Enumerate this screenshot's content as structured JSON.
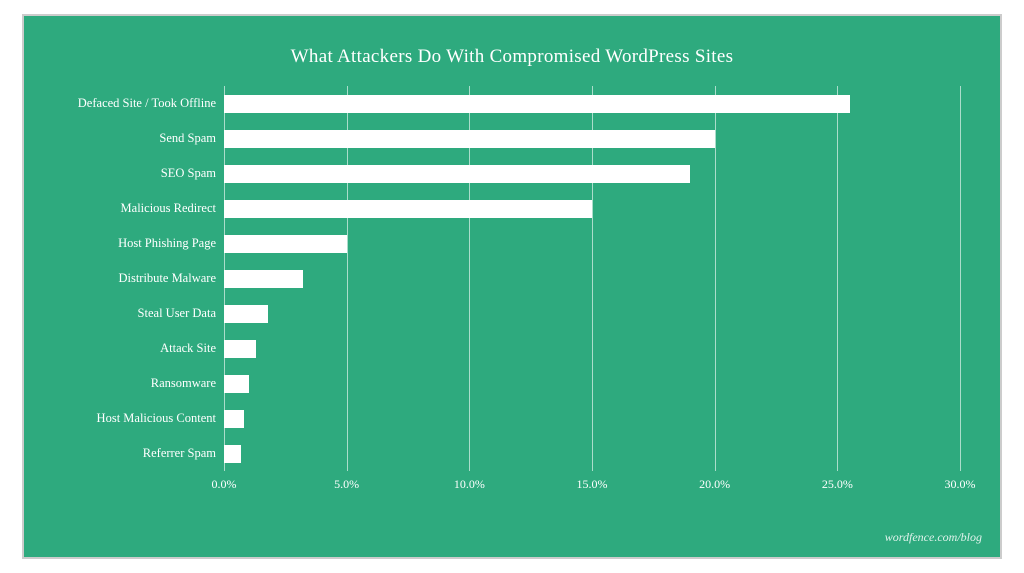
{
  "chart": {
    "title": "What Attackers Do With Compromised WordPress Sites",
    "watermark": "wordfence.com/blog",
    "bars": [
      {
        "label": "Defaced Site / Took Offline",
        "value": 25.5,
        "max": 30
      },
      {
        "label": "Send Spam",
        "value": 20.0,
        "max": 30
      },
      {
        "label": "SEO Spam",
        "value": 19.0,
        "max": 30
      },
      {
        "label": "Malicious Redirect",
        "value": 15.0,
        "max": 30
      },
      {
        "label": "Host Phishing Page",
        "value": 5.0,
        "max": 30
      },
      {
        "label": "Distribute Malware",
        "value": 3.2,
        "max": 30
      },
      {
        "label": "Steal User Data",
        "value": 1.8,
        "max": 30
      },
      {
        "label": "Attack Site",
        "value": 1.3,
        "max": 30
      },
      {
        "label": "Ransomware",
        "value": 1.0,
        "max": 30
      },
      {
        "label": "Host Malicious Content",
        "value": 0.8,
        "max": 30
      },
      {
        "label": "Referrer Spam",
        "value": 0.7,
        "max": 30
      }
    ],
    "xaxis": {
      "ticks": [
        {
          "label": "0.0%",
          "pct": 0
        },
        {
          "label": "5.0%",
          "pct": 16.667
        },
        {
          "label": "10.0%",
          "pct": 33.333
        },
        {
          "label": "15.0%",
          "pct": 50
        },
        {
          "label": "20.0%",
          "pct": 66.667
        },
        {
          "label": "25.0%",
          "pct": 83.333
        },
        {
          "label": "30.0%",
          "pct": 100
        }
      ]
    }
  }
}
